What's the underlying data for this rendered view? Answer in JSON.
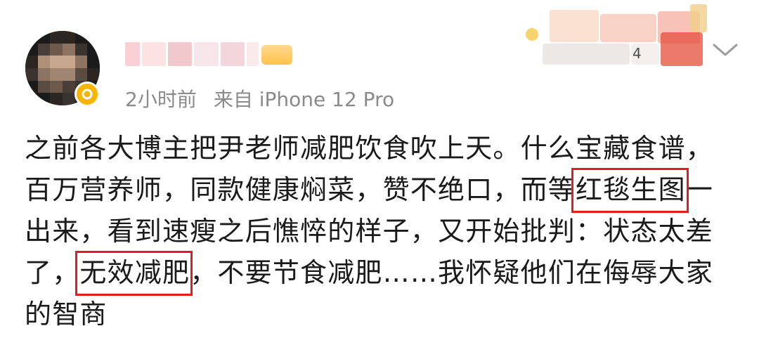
{
  "post": {
    "username": "",
    "time": "2小时前",
    "source": "来自 iPhone 12 Pro",
    "text_parts": {
      "p1": "之前各大博主把尹老师减肥饮食吹上天。什么宝藏食谱，百万营养师，同款健康焖菜，赞不绝口，而等",
      "h1": "红毯生图",
      "p2": "一出来，看到速瘦之后憔悴的样子，又开始批判：状态太差了，",
      "h2": "无效减肥",
      "p3": "，不要节食减肥……我怀疑他们在侮辱大家的智商"
    },
    "decor_number": "4"
  },
  "colors": {
    "highlight_border": "#e31c1c",
    "meta_text": "#8a8a8a",
    "verified": "#f7b500"
  },
  "icons": {
    "verified": "verified-badge-icon",
    "menu": "chevron-down-icon"
  }
}
